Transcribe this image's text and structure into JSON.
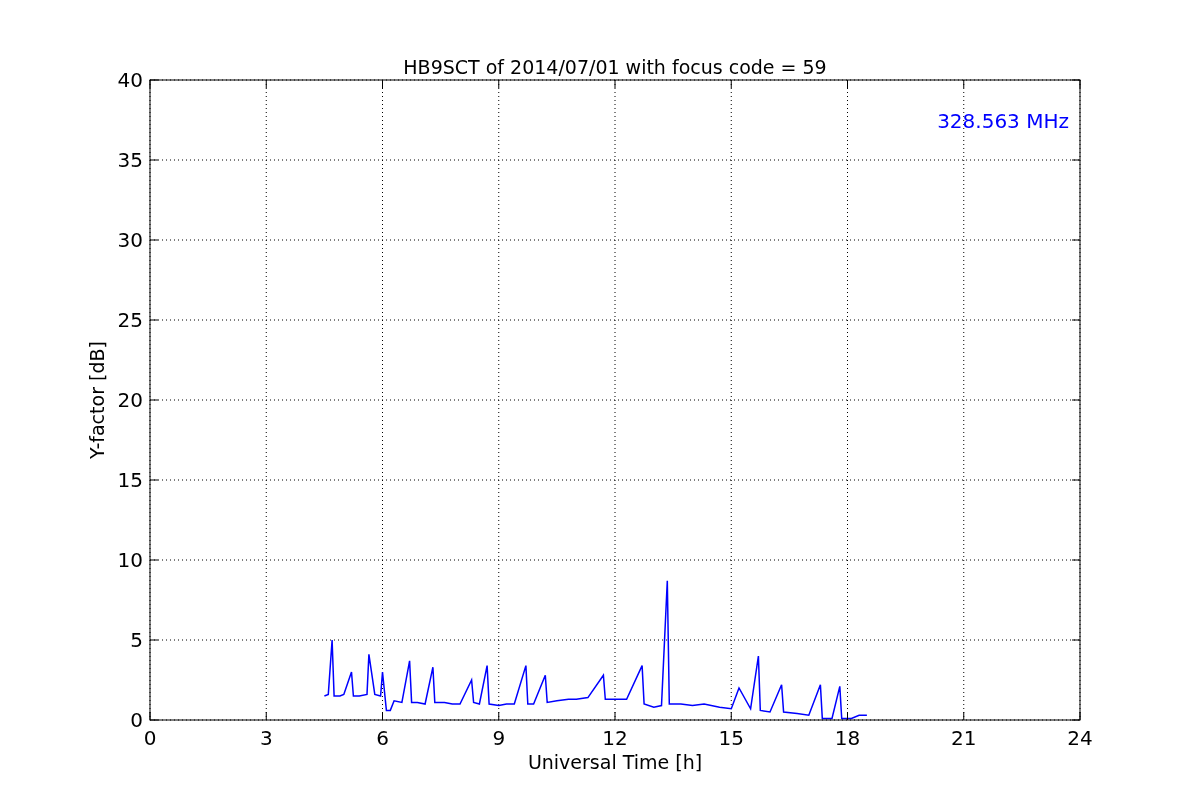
{
  "figure": {
    "chart_data": {
      "type": "line",
      "title": "HB9SCT of 2014/07/01 with focus code = 59",
      "xlabel": "Universal Time [h]",
      "ylabel": "Y-factor [dB]",
      "x": [
        4.5,
        4.6,
        4.7,
        4.75,
        4.9,
        5.0,
        5.2,
        5.25,
        5.4,
        5.6,
        5.65,
        5.8,
        5.95,
        6.0,
        6.1,
        6.2,
        6.3,
        6.5,
        6.7,
        6.75,
        6.9,
        7.1,
        7.3,
        7.35,
        7.6,
        7.8,
        8.0,
        8.3,
        8.35,
        8.5,
        8.7,
        8.75,
        9.0,
        9.2,
        9.4,
        9.7,
        9.75,
        9.9,
        10.2,
        10.25,
        10.5,
        10.8,
        11.0,
        11.3,
        11.7,
        11.75,
        12.0,
        12.3,
        12.7,
        12.75,
        13.0,
        13.2,
        13.35,
        13.4,
        13.7,
        14.0,
        14.3,
        14.7,
        15.0,
        15.2,
        15.5,
        15.7,
        15.75,
        16.0,
        16.3,
        16.35,
        16.7,
        17.0,
        17.3,
        17.35,
        17.6,
        17.8,
        17.85,
        18.1,
        18.3,
        18.5
      ],
      "series": [
        {
          "name": "328.563 MHz",
          "color": "#0000ff",
          "values": [
            1.5,
            1.6,
            5.0,
            1.5,
            1.5,
            1.6,
            3.0,
            1.5,
            1.5,
            1.6,
            4.1,
            1.6,
            1.5,
            3.0,
            0.6,
            0.6,
            1.2,
            1.1,
            3.7,
            1.1,
            1.1,
            1.0,
            3.3,
            1.1,
            1.1,
            1.0,
            1.0,
            2.5,
            1.1,
            1.0,
            3.4,
            1.0,
            0.9,
            1.0,
            1.0,
            3.4,
            1.0,
            1.0,
            2.8,
            1.1,
            1.2,
            1.3,
            1.3,
            1.4,
            2.8,
            1.3,
            1.3,
            1.3,
            3.4,
            1.0,
            0.8,
            0.9,
            8.7,
            1.0,
            1.0,
            0.9,
            1.0,
            0.8,
            0.7,
            2.0,
            0.7,
            4.0,
            0.6,
            0.5,
            2.2,
            0.5,
            0.4,
            0.3,
            2.2,
            0.1,
            0.1,
            2.1,
            0.1,
            0.1,
            0.3,
            0.3
          ]
        }
      ],
      "xlim": [
        0,
        24
      ],
      "ylim": [
        0,
        40
      ],
      "grid": true,
      "xticks": [
        0,
        3,
        6,
        9,
        12,
        15,
        18,
        21,
        24
      ],
      "yticks": [
        0,
        5,
        10,
        15,
        20,
        25,
        30,
        35,
        40
      ]
    }
  }
}
